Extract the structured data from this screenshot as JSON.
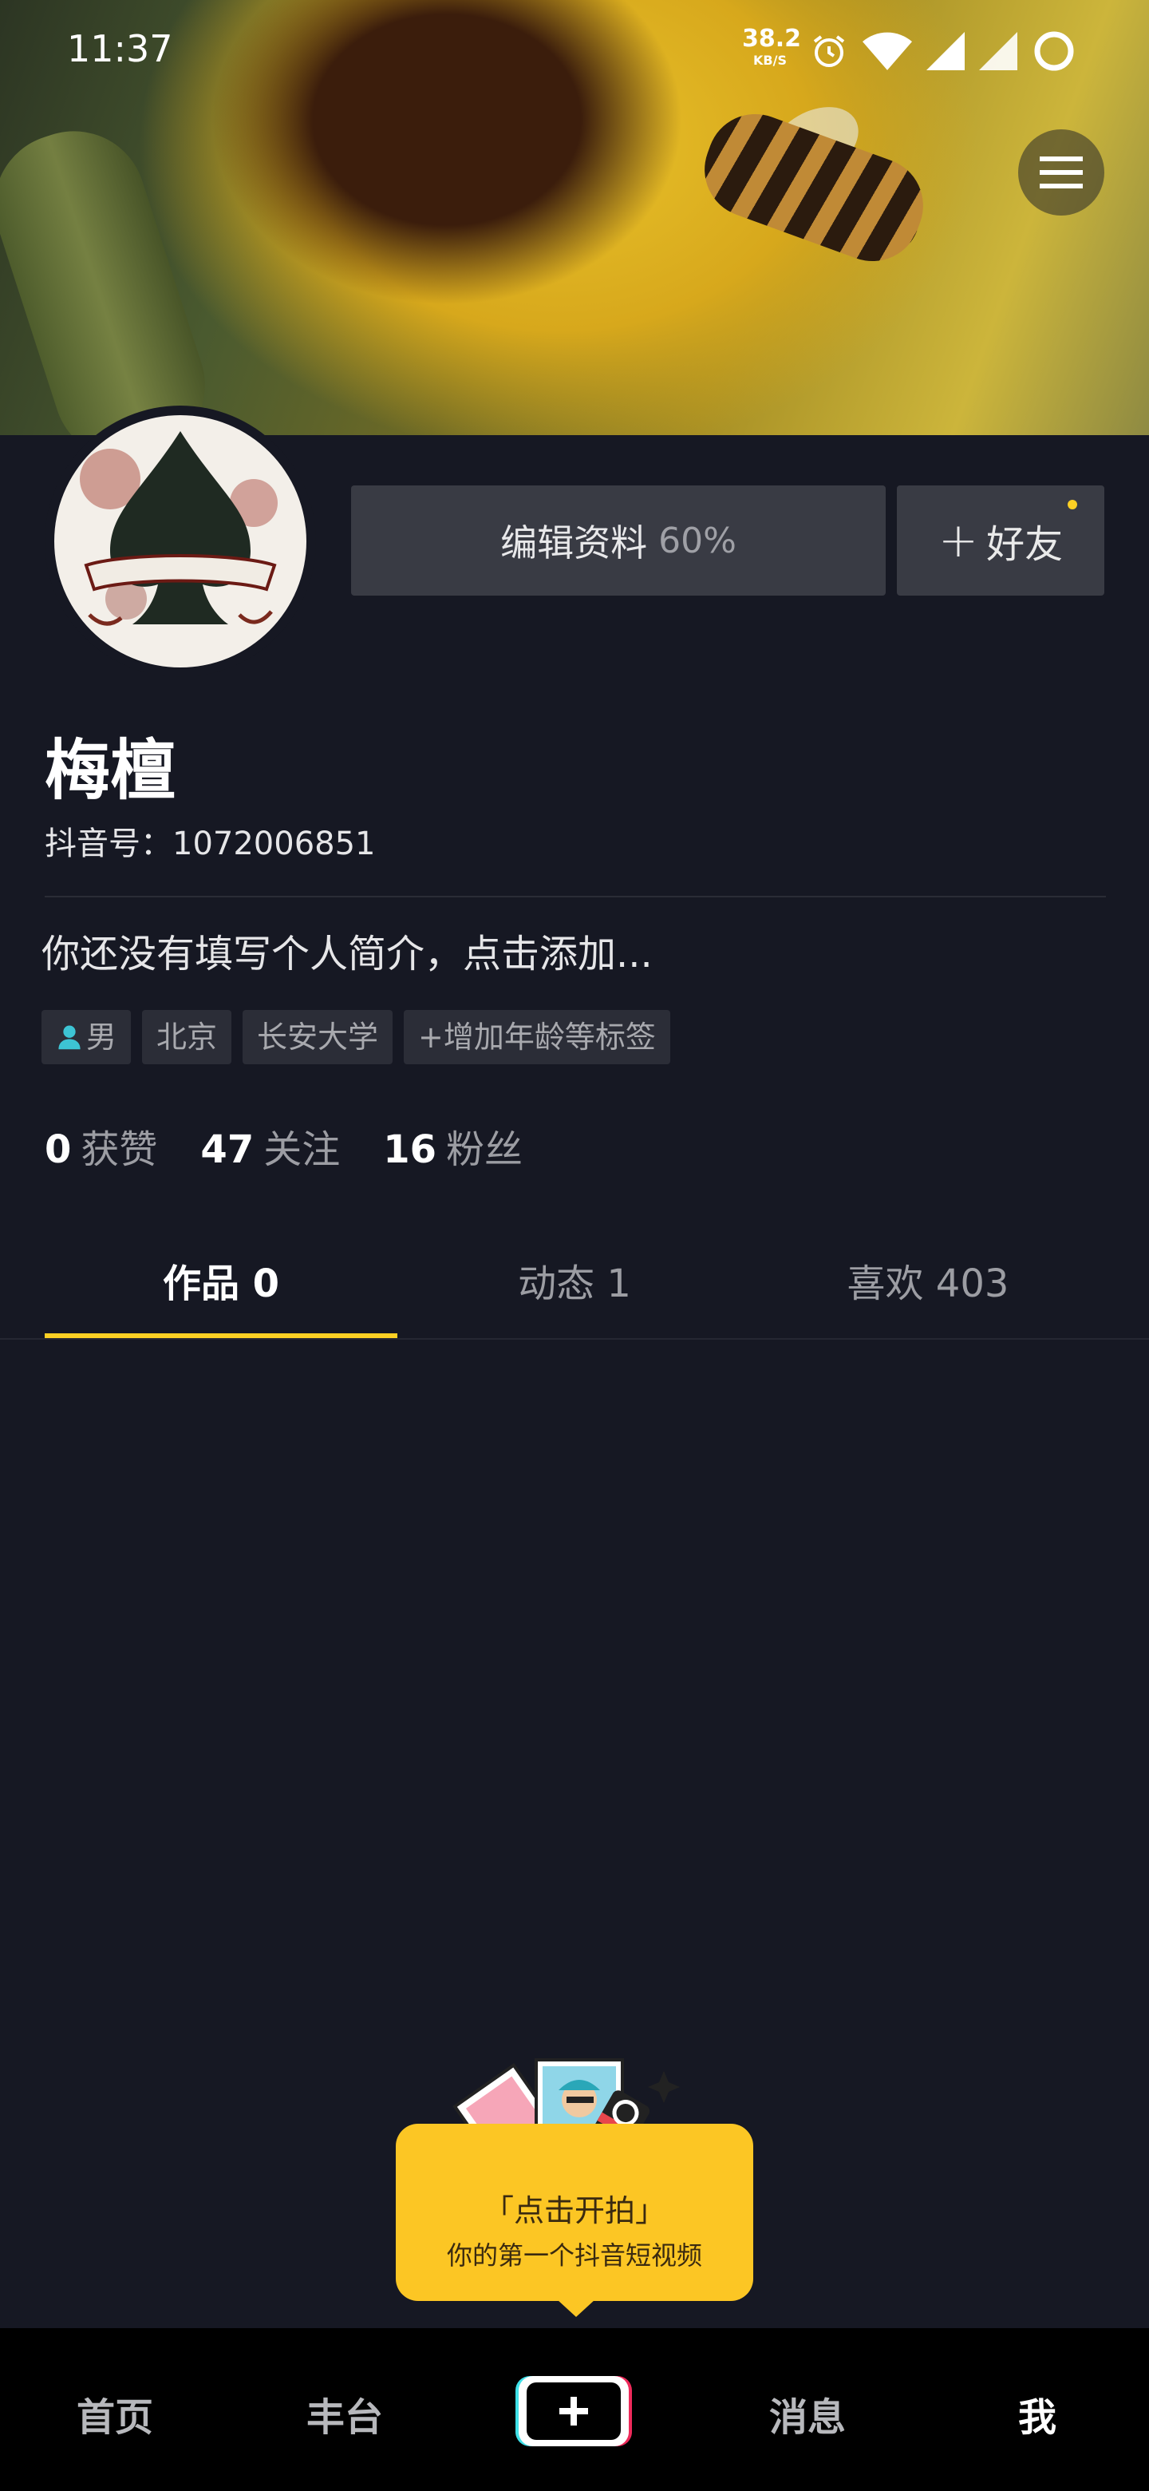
{
  "status_bar": {
    "time": "11:37",
    "net_speed_value": "38.2",
    "net_speed_unit": "KB/S",
    "icons": [
      "alarm-icon",
      "wifi-icon",
      "signal-icon",
      "signal-icon-2",
      "battery-ring-icon"
    ]
  },
  "header": {
    "menu_icon": "hamburger-menu-icon"
  },
  "profile": {
    "edit_button_label": "编辑资料",
    "edit_progress": "60%",
    "add_friend_label": "好友",
    "nickname": "梅檀",
    "douyin_id": "抖音号：1072006851",
    "bio_placeholder": "你还没有填写个人简介，点击添加...",
    "tags": [
      "男",
      "北京",
      "长安大学",
      "+增加年龄等标签"
    ]
  },
  "stats": [
    {
      "value": "0",
      "label": "获赞"
    },
    {
      "value": "47",
      "label": "关注"
    },
    {
      "value": "16",
      "label": "粉丝"
    }
  ],
  "tabs": [
    {
      "label": "作品 0",
      "active": true
    },
    {
      "label": "动态 1",
      "active": false
    },
    {
      "label": "喜欢 403",
      "active": false
    }
  ],
  "prompt": {
    "title": "「点击开拍」",
    "subtitle": "你的第一个抖音短视频"
  },
  "bottom_nav": {
    "items": [
      "首页",
      "丰台",
      "消息",
      "我"
    ],
    "active": "我"
  },
  "colors": {
    "background": "#161823",
    "accent": "#fdd024",
    "button_bg": "#393b44"
  }
}
